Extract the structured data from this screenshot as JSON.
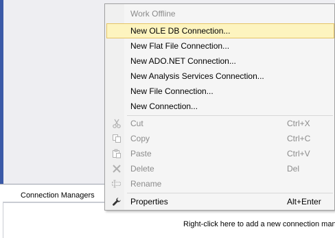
{
  "connection_managers": {
    "tab_label": "Connection Managers",
    "hint": "Right-click here to add a new connection mana"
  },
  "menu": {
    "items": [
      {
        "label": "Work Offline",
        "shortcut": "",
        "icon": "",
        "enabled": false,
        "highlighted": false
      },
      {
        "label": "New OLE DB Connection...",
        "shortcut": "",
        "icon": "",
        "enabled": true,
        "highlighted": true
      },
      {
        "label": "New Flat File Connection...",
        "shortcut": "",
        "icon": "",
        "enabled": true,
        "highlighted": false
      },
      {
        "label": "New ADO.NET Connection...",
        "shortcut": "",
        "icon": "",
        "enabled": true,
        "highlighted": false
      },
      {
        "label": "New Analysis Services Connection...",
        "shortcut": "",
        "icon": "",
        "enabled": true,
        "highlighted": false
      },
      {
        "label": "New File Connection...",
        "shortcut": "",
        "icon": "",
        "enabled": true,
        "highlighted": false
      },
      {
        "label": "New Connection...",
        "shortcut": "",
        "icon": "",
        "enabled": true,
        "highlighted": false
      },
      {
        "label": "Cut",
        "shortcut": "Ctrl+X",
        "icon": "scissors-icon",
        "enabled": false,
        "highlighted": false
      },
      {
        "label": "Copy",
        "shortcut": "Ctrl+C",
        "icon": "copy-icon",
        "enabled": false,
        "highlighted": false
      },
      {
        "label": "Paste",
        "shortcut": "Ctrl+V",
        "icon": "paste-icon",
        "enabled": false,
        "highlighted": false
      },
      {
        "label": "Delete",
        "shortcut": "Del",
        "icon": "delete-icon",
        "enabled": false,
        "highlighted": false
      },
      {
        "label": "Rename",
        "shortcut": "",
        "icon": "rename-icon",
        "enabled": false,
        "highlighted": false
      },
      {
        "label": "Properties",
        "shortcut": "Alt+Enter",
        "icon": "wrench-icon",
        "enabled": true,
        "highlighted": false
      }
    ]
  },
  "colors": {
    "highlight_bg": "#fdf4bf",
    "highlight_border": "#e5c365",
    "disabled_text": "#8b8b8b",
    "menu_bg": "#f5f5f5",
    "canvas_bg": "#eeeef2"
  }
}
